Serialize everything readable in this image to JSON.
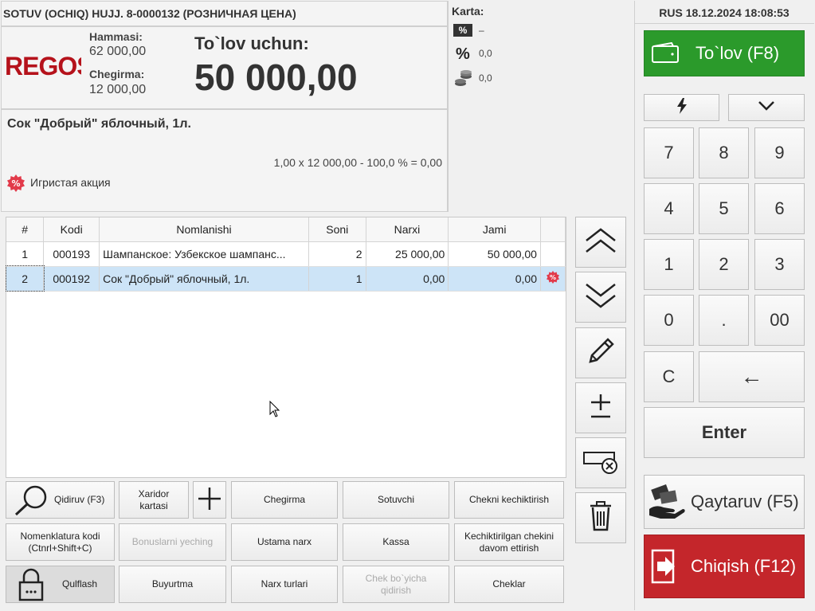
{
  "header": {
    "doc_title": "SOTUV (OCHIQ) HUJJ. 8-0000132  (РОЗНИЧНАЯ ЦЕНА)",
    "logo": "REGOS",
    "total_label": "Hammasi:",
    "total_value": "62 000,00",
    "discount_label": "Chegirma:",
    "discount_value": "12 000,00",
    "pay_label": "To`lov uchun:",
    "pay_value": "50 000,00"
  },
  "karta": {
    "label": "Karta:",
    "percent_badge_value": "–",
    "percent_value": "0,0",
    "coins_value": "0,0"
  },
  "selected_item": {
    "name": "Сок \"Добрый\" яблочный, 1л.",
    "formula": "1,00 x 12 000,00 - 100,0 % = 0,00",
    "promo": "Игристая акция"
  },
  "status": {
    "text": "RUS 18.12.2024 18:08:53"
  },
  "table": {
    "columns": [
      "#",
      "Kodi",
      "Nomlanishi",
      "Soni",
      "Narxi",
      "Jami",
      ""
    ],
    "rows": [
      {
        "n": "1",
        "code": "000193",
        "name": "Шампанское: Узбекское шампанс...",
        "qty": "2",
        "price": "25 000,00",
        "sum": "50 000,00",
        "promo": false
      },
      {
        "n": "2",
        "code": "000192",
        "name": "Сок \"Добрый\" яблочный, 1л.",
        "qty": "1",
        "price": "0,00",
        "sum": "0,00",
        "promo": true
      }
    ]
  },
  "keypad": {
    "pay_button": "To`lov (F8)",
    "keys": [
      "7",
      "8",
      "9",
      "4",
      "5",
      "6",
      "1",
      "2",
      "3",
      "0",
      ".",
      "00",
      "C",
      "←"
    ],
    "enter": "Enter",
    "return_button": "Qaytaruv (F5)",
    "exit_button": "Chiqish (F12)"
  },
  "bottom": {
    "search": "Qidiruv (F3)",
    "customer_card": "Xaridor\nkartasi",
    "discount": "Chegirma",
    "seller": "Sotuvchi",
    "delay_check": "Chekni kechiktirish",
    "nomenclature_code": "Nomenklatura kodi\n(Ctnrl+Shift+C)",
    "bonuses": "Bonuslarni yeching",
    "master_price": "Ustama narx",
    "cashbox": "Kassa",
    "continue_delayed": "Kechiktirilgan chekini\ndavom ettirish",
    "lock": "Qulflash",
    "order": "Buyurtma",
    "price_types": "Narx turlari",
    "search_by_check": "Chek bo`yicha\nqidirish",
    "checks": "Cheklar"
  },
  "colors": {
    "pay_green": "#2b9a2b",
    "exit_red": "#c4262b",
    "logo_red": "#b5121b",
    "selection_blue": "#cde4f7"
  }
}
